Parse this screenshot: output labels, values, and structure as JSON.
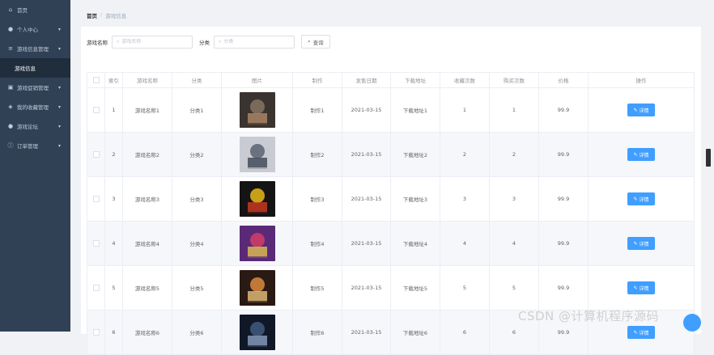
{
  "sidebar": {
    "items": [
      {
        "label": "首页",
        "icon": "home-icon",
        "glyph": "⌂",
        "expandable": false
      },
      {
        "label": "个人中心",
        "icon": "user-icon",
        "glyph": "●",
        "expandable": true
      },
      {
        "label": "游戏信息管理",
        "icon": "list-icon",
        "glyph": "≡",
        "expandable": true
      },
      {
        "label": "游戏信息",
        "sub": true
      },
      {
        "label": "游戏促销管理",
        "icon": "tag-icon",
        "glyph": "▣",
        "expandable": true
      },
      {
        "label": "我的收藏管理",
        "icon": "location-icon",
        "glyph": "◈",
        "expandable": true
      },
      {
        "label": "游戏论坛",
        "icon": "user-icon",
        "glyph": "●",
        "expandable": true
      },
      {
        "label": "订单管理",
        "icon": "info-icon",
        "glyph": "ⓘ",
        "expandable": true
      }
    ]
  },
  "breadcrumb": {
    "home": "首页",
    "separator": "/",
    "current": "游戏信息"
  },
  "search": {
    "name_label": "游戏名称",
    "name_placeholder": "游戏名称",
    "category_label": "分类",
    "category_placeholder": "分类",
    "query_label": "查询"
  },
  "table": {
    "headers": [
      "索引",
      "游戏名称",
      "分类",
      "图片",
      "制作",
      "发售日期",
      "下载地址",
      "收藏次数",
      "购买次数",
      "价格",
      "操作"
    ],
    "detail_label": "详情",
    "rows": [
      {
        "index": "1",
        "name": "游戏名称1",
        "category": "分类1",
        "maker": "制作1",
        "date": "2021-03-15",
        "download": "下载地址1",
        "favorites": "1",
        "purchases": "1",
        "price": "99.9",
        "colors": [
          "#3a3430",
          "#7a6a5a",
          "#b08868"
        ]
      },
      {
        "index": "2",
        "name": "游戏名称2",
        "category": "分类2",
        "maker": "制作2",
        "date": "2021-03-15",
        "download": "下载地址2",
        "favorites": "2",
        "purchases": "2",
        "price": "99.9",
        "colors": [
          "#c8ccd2",
          "#6a7280",
          "#3c4452"
        ]
      },
      {
        "index": "3",
        "name": "游戏名称3",
        "category": "分类3",
        "maker": "制作3",
        "date": "2021-03-15",
        "download": "下载地址3",
        "favorites": "3",
        "purchases": "3",
        "price": "99.9",
        "colors": [
          "#141414",
          "#c8a018",
          "#d03a20"
        ]
      },
      {
        "index": "4",
        "name": "游戏名称4",
        "category": "分类4",
        "maker": "制作4",
        "date": "2021-03-15",
        "download": "下载地址4",
        "favorites": "4",
        "purchases": "4",
        "price": "99.9",
        "colors": [
          "#5a2a78",
          "#c03a6a",
          "#e0c050"
        ]
      },
      {
        "index": "5",
        "name": "游戏名称5",
        "category": "分类5",
        "maker": "制作5",
        "date": "2021-03-15",
        "download": "下载地址5",
        "favorites": "5",
        "purchases": "5",
        "price": "99.9",
        "colors": [
          "#2a1a14",
          "#c07838",
          "#e8c078"
        ]
      },
      {
        "index": "6",
        "name": "游戏名称6",
        "category": "分类6",
        "maker": "制作6",
        "date": "2021-03-15",
        "download": "下载地址6",
        "favorites": "6",
        "purchases": "6",
        "price": "99.9",
        "colors": [
          "#101828",
          "#3a5070",
          "#8aa0c0"
        ]
      }
    ]
  },
  "watermark": "CSDN @计算机程序源码",
  "colors": {
    "sidebar_bg": "#304156",
    "primary": "#409eff",
    "stripe": "#f5f7fa"
  }
}
